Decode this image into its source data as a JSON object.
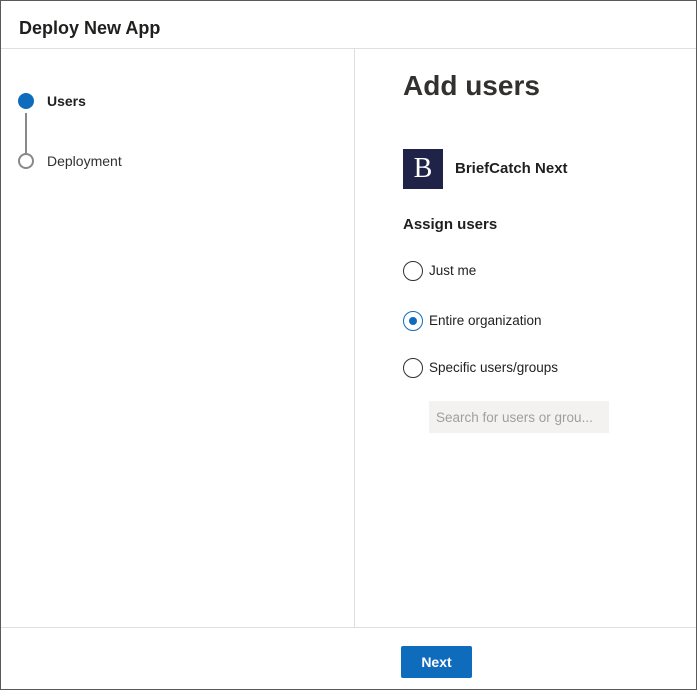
{
  "dialog": {
    "title": "Deploy New App"
  },
  "steps": [
    {
      "label": "Users",
      "state": "active"
    },
    {
      "label": "Deployment",
      "state": "inactive"
    }
  ],
  "main": {
    "heading": "Add users",
    "app": {
      "logo_letter": "B",
      "name": "BriefCatch Next"
    },
    "assign": {
      "label": "Assign users",
      "options": [
        {
          "label": "Just me",
          "selected": false
        },
        {
          "label": "Entire organization",
          "selected": true
        },
        {
          "label": "Specific users/groups",
          "selected": false
        }
      ],
      "search_placeholder": "Search for users or grou...",
      "search_value": ""
    }
  },
  "footer": {
    "next_label": "Next"
  },
  "colors": {
    "accent": "#0f6cbd",
    "logo_background": "#1f2347"
  }
}
